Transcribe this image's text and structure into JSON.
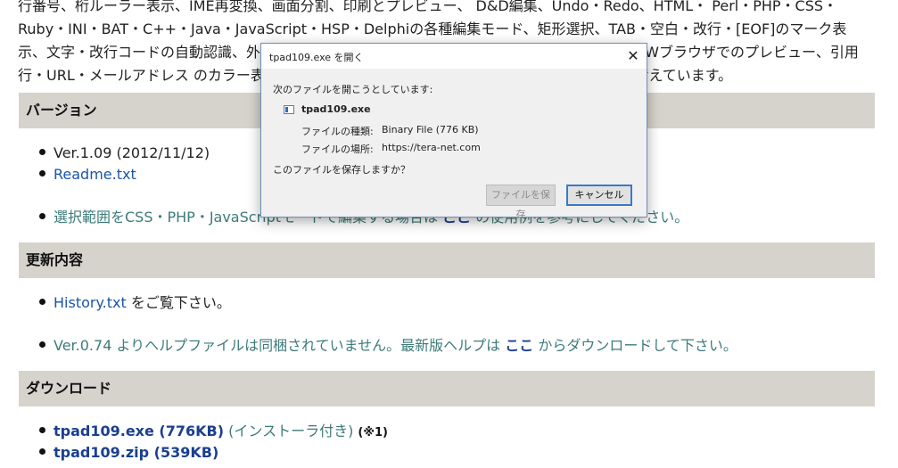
{
  "intro": {
    "line1": "行番号、桁ルーラー表示、IME再変換、画面分割、印刷とプレビュー、 D&D編集、Undo・Redo、HTML・ Perl・PHP・CSS・",
    "line2": "Ruby・INI・BAT・C++・Java・JavaScript・HSP・Delphiの各種編集モード、矩形選択、TAB・空白・改行・[EOF]のマーク表",
    "line3": "示、文字・改行コードの自動認識、外部プログラムの起動、排他制御、標準入力の取り込み、WWWブラウザでのプレビュー、引用",
    "line4": "行・URL・メールアドレス のカラー表示、テキストの整形、日本語検索機能など、多数の機能を備えています。"
  },
  "version": {
    "heading": "バージョン",
    "ver": "Ver.1.09 (2012/11/12)",
    "readme": "Readme.txt",
    "note_pre": "選択範囲をCSS・PHP・JavaScriptモードで編集する場合は",
    "note_link": "ここ",
    "note_post": "の使用例を参考にしてください。"
  },
  "changes": {
    "heading": "更新内容",
    "history_link": "History.txt",
    "history_post": "をご覧下さい。",
    "help_pre": "Ver.0.74 よりヘルプファイルは同梱されていません。最新版ヘルプは",
    "help_link": "ここ",
    "help_post": "からダウンロードして下さい。"
  },
  "download": {
    "heading": "ダウンロード",
    "exe_link": "tpad109.exe (776KB)",
    "exe_note": "(インストーラ付き)",
    "exe_mark": "(※1)",
    "zip_link": "tpad109.zip (539KB)"
  },
  "dialog": {
    "title": "tpad109.exe を開く",
    "close": "✕",
    "prompt": "次のファイルを開こうとしています:",
    "filename": "tpad109.exe",
    "type_label": "ファイルの種類:",
    "type_value": "Binary File (776 KB)",
    "location_label": "ファイルの場所:",
    "location_value": "https://tera-net.com",
    "question": "このファイルを保存しますか？",
    "save_button": "ファイルを保存",
    "cancel_button": "キャンセル"
  }
}
